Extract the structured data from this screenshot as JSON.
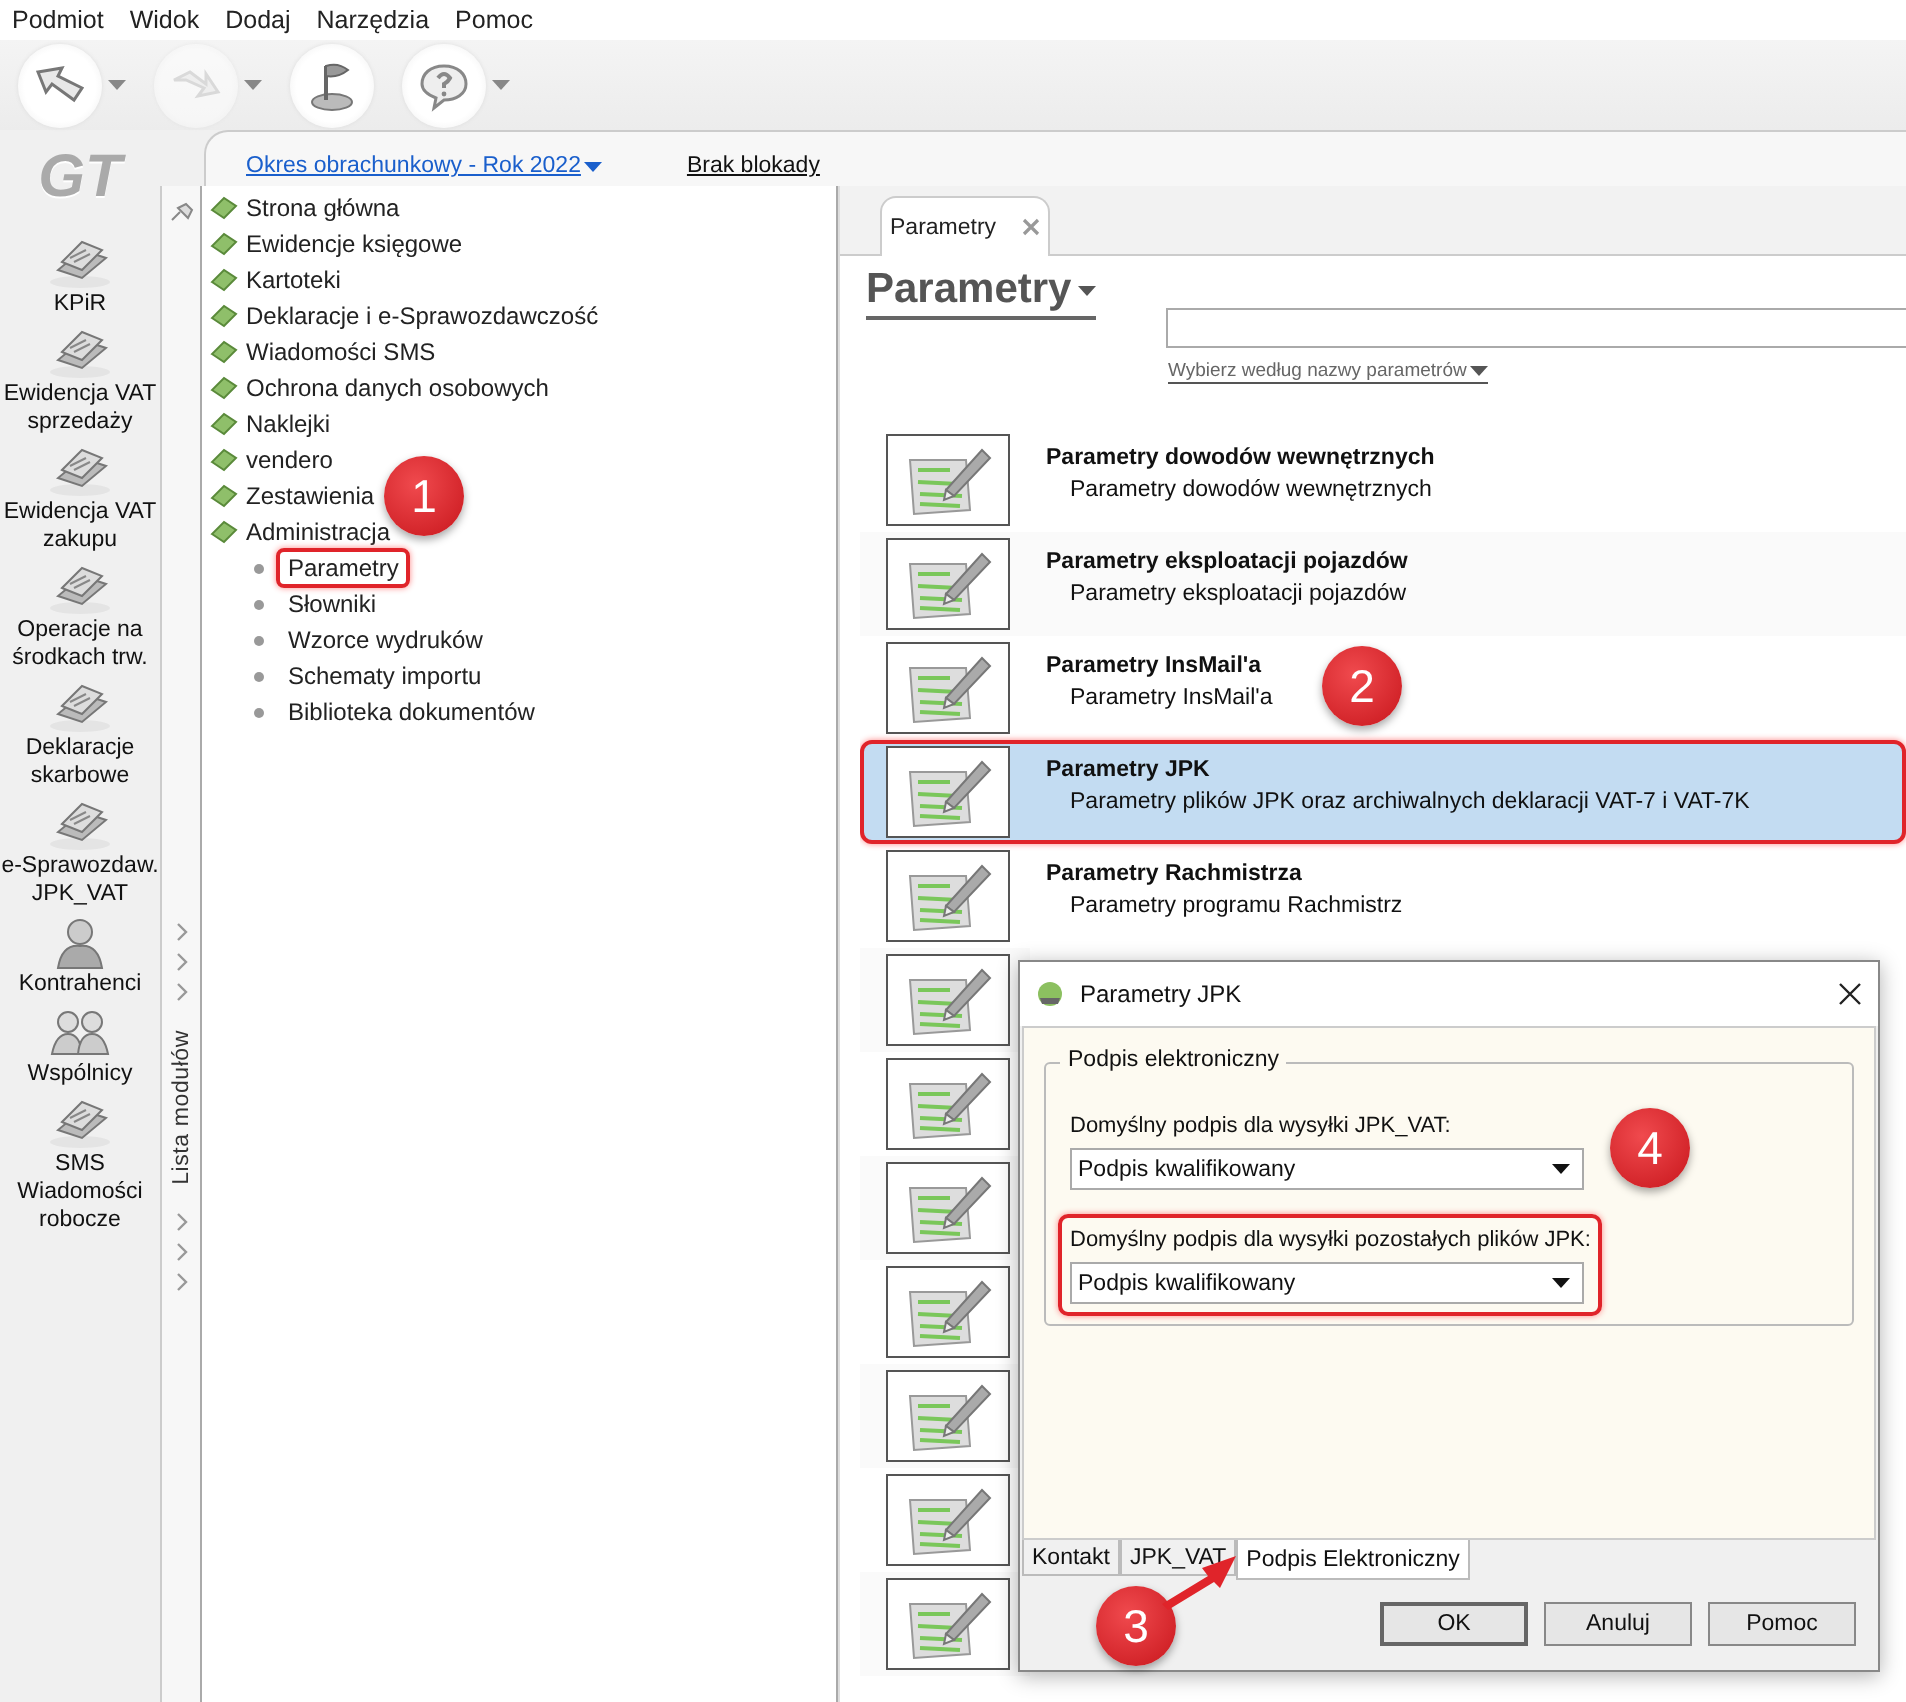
{
  "menu": [
    "Podmiot",
    "Widok",
    "Dodaj",
    "Narzędzia",
    "Pomoc"
  ],
  "toolbar": [
    {
      "kind": "back",
      "disabled": false,
      "dropdown": true
    },
    {
      "kind": "forward",
      "disabled": true,
      "dropdown": true
    },
    {
      "kind": "flag",
      "disabled": false,
      "dropdown": false
    },
    {
      "kind": "help",
      "disabled": false,
      "dropdown": true
    }
  ],
  "logo": "GT",
  "modules": [
    {
      "label": "KPiR",
      "kind": "document"
    },
    {
      "label": "Ewidencja VAT\nsprzedaży",
      "kind": "document"
    },
    {
      "label": "Ewidencja VAT\nzakupu",
      "kind": "document"
    },
    {
      "label": "Operacje na\nśrodkach trw.",
      "kind": "document"
    },
    {
      "label": "Deklaracje\nskarbowe",
      "kind": "document"
    },
    {
      "label": "e-Sprawozdaw.\nJPK_VAT",
      "kind": "document"
    },
    {
      "label": "Kontrahenci",
      "kind": "person"
    },
    {
      "label": "Wspólnicy",
      "kind": "people"
    },
    {
      "label": "SMS\nWiadomości\nrobocze",
      "kind": "document"
    }
  ],
  "period": "Okres obrachunkowy - Rok 2022",
  "lock_status": "Brak blokady",
  "module_strip_label": "Lista modułów",
  "tree": [
    {
      "label": "Strona główna"
    },
    {
      "label": "Ewidencje księgowe"
    },
    {
      "label": "Kartoteki"
    },
    {
      "label": "Deklaracje i e-Sprawozdawczość"
    },
    {
      "label": "Wiadomości SMS"
    },
    {
      "label": "Ochrona danych osobowych"
    },
    {
      "label": "Naklejki"
    },
    {
      "label": "vendero"
    },
    {
      "label": "Zestawienia"
    },
    {
      "label": "Administracja",
      "expanded": true,
      "children": [
        {
          "label": "Parametry",
          "annotated": true
        },
        {
          "label": "Słowniki",
          "annotated": false
        },
        {
          "label": "Wzorce wydruków",
          "annotated": false
        },
        {
          "label": "Schematy importu",
          "annotated": false
        },
        {
          "label": "Biblioteka dokumentów",
          "annotated": false
        }
      ]
    }
  ],
  "tab": {
    "label": "Parametry"
  },
  "heading": "Parametry",
  "filter_link": "Wybierz według nazwy parametrów",
  "params": [
    {
      "title": "Parametry dowodów wewnętrznych",
      "subtitle": "Parametry dowodów wewnętrznych",
      "selected": false,
      "annotated": false
    },
    {
      "title": "Parametry eksploatacji pojazdów",
      "subtitle": "Parametry eksploatacji pojazdów",
      "selected": false,
      "annotated": false
    },
    {
      "title": "Parametry InsMail'a",
      "subtitle": "Parametry InsMail'a",
      "selected": false,
      "annotated": false
    },
    {
      "title": "Parametry JPK",
      "subtitle": "Parametry plików JPK oraz archiwalnych deklaracji VAT-7 i VAT-7K",
      "selected": true,
      "annotated": true
    },
    {
      "title": "Parametry Rachmistrza",
      "subtitle": "Parametry programu Rachmistrz",
      "selected": false,
      "annotated": false
    },
    {
      "selected": false,
      "annotated": false
    },
    {
      "selected": false,
      "annotated": false
    },
    {
      "selected": false,
      "annotated": false
    },
    {
      "selected": false,
      "annotated": false
    },
    {
      "selected": false,
      "annotated": false
    },
    {
      "selected": false,
      "annotated": false
    },
    {
      "selected": false,
      "annotated": false
    }
  ],
  "dialog": {
    "title": "Parametry JPK",
    "group": "Podpis elektroniczny",
    "fields": [
      {
        "label": "Domyślny podpis dla wysyłki JPK_VAT:",
        "value": "Podpis kwalifikowany",
        "annotated": false
      },
      {
        "label": "Domyślny podpis dla wysyłki pozostałych plików JPK:",
        "value": "Podpis kwalifikowany",
        "annotated": true
      }
    ],
    "tabs": [
      {
        "label": "Kontakt",
        "selected": false
      },
      {
        "label": "JPK_VAT",
        "selected": false
      },
      {
        "label": "Podpis Elektroniczny",
        "selected": true
      }
    ],
    "buttons": [
      "OK",
      "Anuluj",
      "Pomoc"
    ]
  },
  "annotations": [
    {
      "number": "1"
    },
    {
      "number": "2"
    },
    {
      "number": "3"
    },
    {
      "number": "4"
    }
  ]
}
